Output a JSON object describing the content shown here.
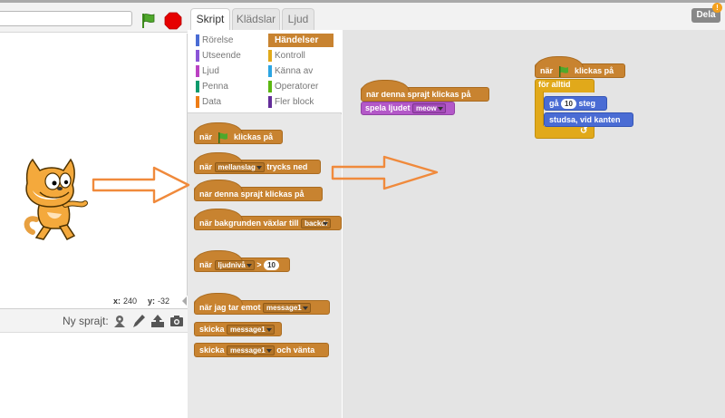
{
  "tabs": [
    {
      "label": "Skript",
      "active": true
    },
    {
      "label": "Klädslar",
      "active": false
    },
    {
      "label": "Ljud",
      "active": false
    }
  ],
  "share": {
    "label": "Dela",
    "badge": "!"
  },
  "stage": {
    "coords": {
      "x_label": "x:",
      "x_value": "240",
      "y_label": "y:",
      "y_value": "-32"
    },
    "new_sprite_label": "Ny sprajt:"
  },
  "categories": [
    {
      "label": "Rörelse",
      "color": "#4a6cd4"
    },
    {
      "label": "Händelser",
      "color": "#c88330",
      "active": true
    },
    {
      "label": "Utseende",
      "color": "#8a55d7"
    },
    {
      "label": "Kontroll",
      "color": "#e1a91a"
    },
    {
      "label": "Ljud",
      "color": "#bb42c3"
    },
    {
      "label": "Känna av",
      "color": "#2ca5e2"
    },
    {
      "label": "Penna",
      "color": "#0e9a6c"
    },
    {
      "label": "Operatorer",
      "color": "#5cb712"
    },
    {
      "label": "Data",
      "color": "#ee7d16"
    },
    {
      "label": "Fler block",
      "color": "#632d99"
    }
  ],
  "palette": {
    "when_flag": {
      "pre": "när",
      "post": "klickas på"
    },
    "when_key": {
      "pre": "när",
      "key": "mellanslag",
      "post": "trycks ned"
    },
    "when_sprite_clicked": "när denna sprajt klickas på",
    "when_backdrop": {
      "pre": "när bakgrunden växlar till",
      "value": "backdr"
    },
    "when_loudness": {
      "pre": "när",
      "sensor": "ljudnivå",
      "op": ">",
      "value": "10"
    },
    "when_receive": {
      "pre": "när jag tar emot",
      "value": "message1"
    },
    "broadcast": {
      "pre": "skicka",
      "value": "message1"
    },
    "broadcast_wait": {
      "pre": "skicka",
      "value": "message1",
      "post": "och vänta"
    }
  },
  "scripts": {
    "script1": {
      "hat": "när denna sprajt klickas på",
      "play_sound": {
        "pre": "spela ljudet",
        "value": "meow"
      }
    },
    "script2": {
      "hat": {
        "pre": "när",
        "post": "klickas på"
      },
      "forever": "för alltid",
      "move": {
        "pre": "gå",
        "value": "10",
        "post": "steg"
      },
      "bounce": "studsa, vid kanten",
      "loop_arrow": "↺"
    }
  },
  "colors": {
    "events": "#c88330",
    "control": "#e1a91a",
    "motion": "#4a6cd4",
    "sound": "#b358c8",
    "arrow": "#f08a3c",
    "stop": "#e60000",
    "flag": "#3f8d1f"
  }
}
